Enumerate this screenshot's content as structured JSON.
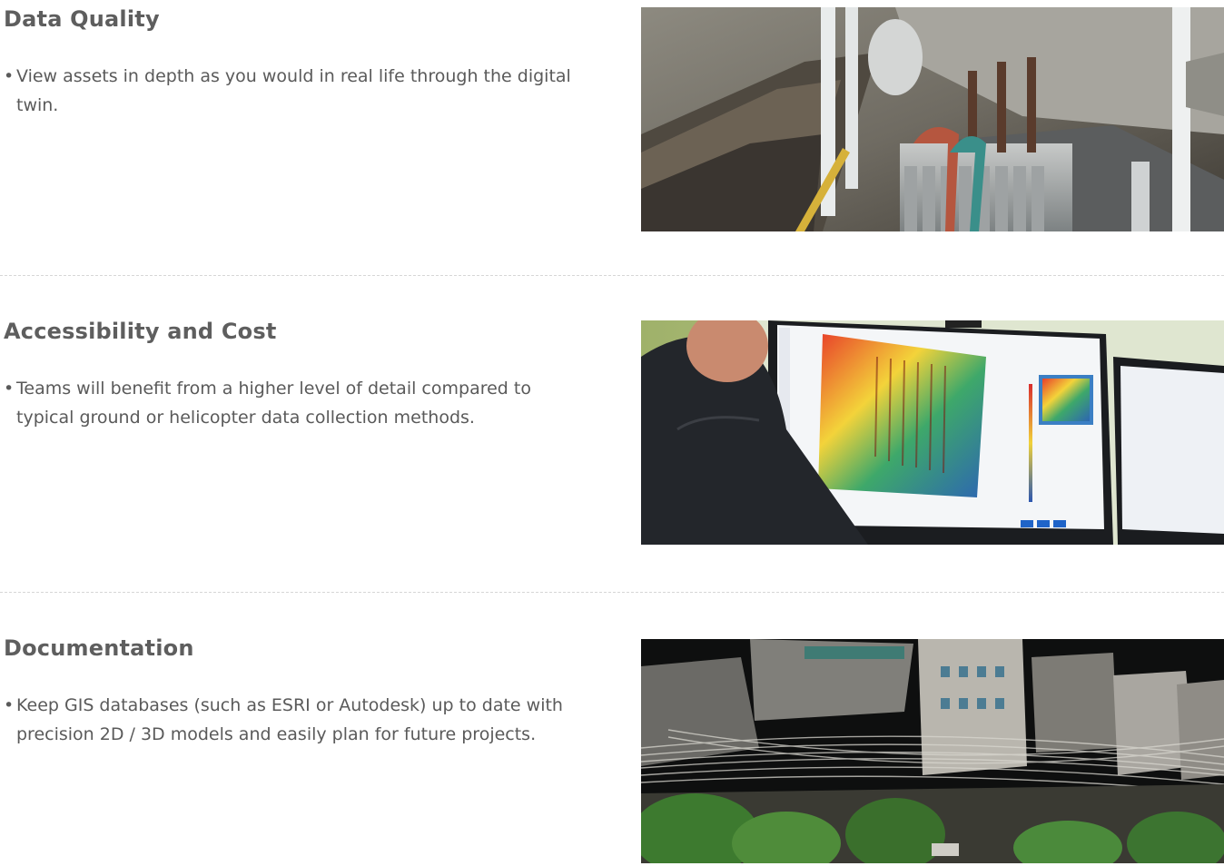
{
  "sections": [
    {
      "title": "Data Quality",
      "bullet": "View assets in depth as you would in real life through the digital twin.",
      "image_subject": "substation-transformer-photo"
    },
    {
      "title": "Accessibility and Cost",
      "bullet": "Teams will benefit from a higher level of detail compared to typical ground or helicopter data collection methods.",
      "image_subject": "thermal-model-monitor-photo"
    },
    {
      "title": "Documentation",
      "bullet": "Keep GIS databases (such as ESRI or Autodesk) up to date with precision 2D / 3D models and easily plan for future projects.",
      "image_subject": "point-cloud-city-photo"
    }
  ],
  "bullet_glyph": "•",
  "colors": {
    "title": "#5e5e5e",
    "body": "#5a5a5a",
    "divider": "#d6d6d6"
  }
}
